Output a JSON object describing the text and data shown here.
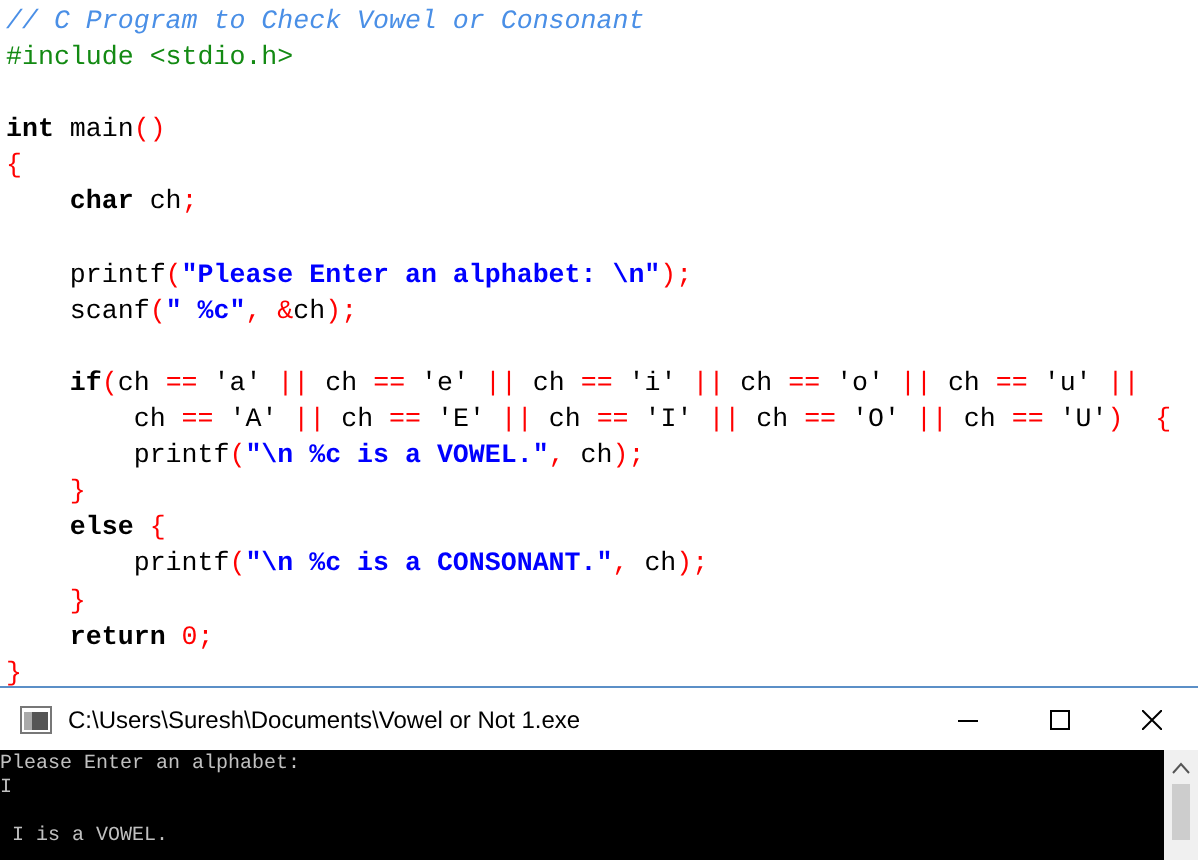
{
  "editor": {
    "lines": [
      {
        "kind": "code",
        "tokens": [
          {
            "kind": "comment",
            "text": "// C Program to Check Vowel or Consonant"
          }
        ]
      },
      {
        "kind": "code",
        "tokens": [
          {
            "kind": "pre",
            "text": "#include <stdio.h>"
          }
        ]
      },
      {
        "kind": "blank"
      },
      {
        "kind": "code",
        "tokens": [
          {
            "kind": "kw",
            "text": "int"
          },
          {
            "kind": "txt",
            "text": " main"
          },
          {
            "kind": "op",
            "text": "()"
          }
        ]
      },
      {
        "kind": "code",
        "tokens": [
          {
            "kind": "op",
            "text": "{"
          }
        ]
      },
      {
        "kind": "code",
        "tokens": [
          {
            "kind": "kw",
            "text": "    char"
          },
          {
            "kind": "txt",
            "text": " ch"
          },
          {
            "kind": "op",
            "text": ";"
          }
        ]
      },
      {
        "kind": "blank"
      },
      {
        "kind": "code",
        "tokens": [
          {
            "kind": "txt",
            "text": "    printf"
          },
          {
            "kind": "op",
            "text": "("
          },
          {
            "kind": "str",
            "text": "\"Please Enter an alphabet: \\n\""
          },
          {
            "kind": "op",
            "text": ");"
          }
        ]
      },
      {
        "kind": "code",
        "tokens": [
          {
            "kind": "txt",
            "text": "    scanf"
          },
          {
            "kind": "op",
            "text": "("
          },
          {
            "kind": "str",
            "text": "\" %c\""
          },
          {
            "kind": "op",
            "text": ","
          },
          {
            "kind": "op",
            "text": " &"
          },
          {
            "kind": "txt",
            "text": "ch"
          },
          {
            "kind": "op",
            "text": ");"
          }
        ]
      },
      {
        "kind": "blank"
      },
      {
        "kind": "code",
        "tokens": [
          {
            "kind": "kw",
            "text": "    if"
          },
          {
            "kind": "op",
            "text": "("
          },
          {
            "kind": "txt",
            "text": "ch "
          },
          {
            "kind": "op",
            "text": "=="
          },
          {
            "kind": "txt",
            "text": " 'a' "
          },
          {
            "kind": "op",
            "text": "||"
          },
          {
            "kind": "txt",
            "text": " ch "
          },
          {
            "kind": "op",
            "text": "=="
          },
          {
            "kind": "txt",
            "text": " 'e' "
          },
          {
            "kind": "op",
            "text": "||"
          },
          {
            "kind": "txt",
            "text": " ch "
          },
          {
            "kind": "op",
            "text": "=="
          },
          {
            "kind": "txt",
            "text": " 'i' "
          },
          {
            "kind": "op",
            "text": "||"
          },
          {
            "kind": "txt",
            "text": " ch "
          },
          {
            "kind": "op",
            "text": "=="
          },
          {
            "kind": "txt",
            "text": " 'o' "
          },
          {
            "kind": "op",
            "text": "||"
          },
          {
            "kind": "txt",
            "text": " ch "
          },
          {
            "kind": "op",
            "text": "=="
          },
          {
            "kind": "txt",
            "text": " 'u' "
          },
          {
            "kind": "op",
            "text": "||"
          }
        ]
      },
      {
        "kind": "code",
        "tokens": [
          {
            "kind": "txt",
            "text": "        ch "
          },
          {
            "kind": "op",
            "text": "=="
          },
          {
            "kind": "txt",
            "text": " 'A' "
          },
          {
            "kind": "op",
            "text": "||"
          },
          {
            "kind": "txt",
            "text": " ch "
          },
          {
            "kind": "op",
            "text": "=="
          },
          {
            "kind": "txt",
            "text": " 'E' "
          },
          {
            "kind": "op",
            "text": "||"
          },
          {
            "kind": "txt",
            "text": " ch "
          },
          {
            "kind": "op",
            "text": "=="
          },
          {
            "kind": "txt",
            "text": " 'I' "
          },
          {
            "kind": "op",
            "text": "||"
          },
          {
            "kind": "txt",
            "text": " ch "
          },
          {
            "kind": "op",
            "text": "=="
          },
          {
            "kind": "txt",
            "text": " 'O' "
          },
          {
            "kind": "op",
            "text": "||"
          },
          {
            "kind": "txt",
            "text": " ch "
          },
          {
            "kind": "op",
            "text": "=="
          },
          {
            "kind": "txt",
            "text": " 'U'"
          },
          {
            "kind": "op",
            "text": ")"
          },
          {
            "kind": "op",
            "text": "  {"
          }
        ]
      },
      {
        "kind": "code",
        "tokens": [
          {
            "kind": "txt",
            "text": "        printf"
          },
          {
            "kind": "op",
            "text": "("
          },
          {
            "kind": "str",
            "text": "\"\\n %c is a VOWEL.\""
          },
          {
            "kind": "op",
            "text": ","
          },
          {
            "kind": "txt",
            "text": " ch"
          },
          {
            "kind": "op",
            "text": ");"
          }
        ]
      },
      {
        "kind": "code",
        "tokens": [
          {
            "kind": "op",
            "text": "    }"
          }
        ]
      },
      {
        "kind": "code",
        "tokens": [
          {
            "kind": "kw",
            "text": "    else"
          },
          {
            "kind": "op",
            "text": " {"
          }
        ]
      },
      {
        "kind": "code",
        "tokens": [
          {
            "kind": "txt",
            "text": "        printf"
          },
          {
            "kind": "op",
            "text": "("
          },
          {
            "kind": "str",
            "text": "\"\\n %c is a CONSONANT.\""
          },
          {
            "kind": "op",
            "text": ","
          },
          {
            "kind": "txt",
            "text": " ch"
          },
          {
            "kind": "op",
            "text": ");"
          }
        ]
      },
      {
        "kind": "code",
        "tokens": [
          {
            "kind": "op",
            "text": "    }"
          }
        ]
      },
      {
        "kind": "code",
        "tokens": [
          {
            "kind": "kw",
            "text": "    return"
          },
          {
            "kind": "num",
            "text": " 0"
          },
          {
            "kind": "op",
            "text": ";"
          }
        ]
      },
      {
        "kind": "code",
        "tokens": [
          {
            "kind": "op",
            "text": "}"
          }
        ]
      }
    ]
  },
  "console": {
    "title": "C:\\Users\\Suresh\\Documents\\Vowel or Not 1.exe",
    "lines": [
      {
        "kind": "text",
        "text": "Please Enter an alphabet:"
      },
      {
        "kind": "text",
        "text": "I"
      },
      {
        "kind": "blank"
      },
      {
        "kind": "text",
        "text": " I is a VOWEL."
      }
    ]
  }
}
